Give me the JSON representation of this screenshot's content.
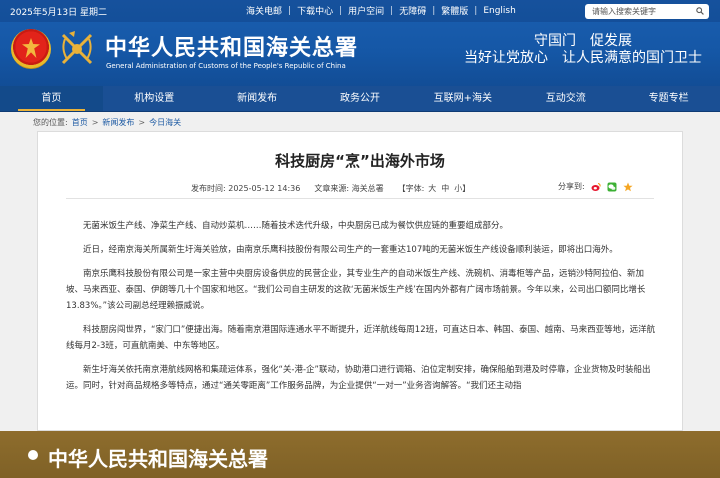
{
  "header": {
    "date": "2025年5月13日 星期二",
    "top_links": [
      "海关电邮",
      "下载中心",
      "用户空间",
      "无障碍",
      "繁體版",
      "English"
    ],
    "search_placeholder": "请输入搜索关键字",
    "site_title_cn": "中华人民共和国海关总署",
    "site_title_en": "General Administration of Customs of the People's Republic of China",
    "slogan_line1": "守国门　促发展",
    "slogan_line2": "当好让党放心　让人民满意的国门卫士"
  },
  "nav": {
    "items": [
      "首页",
      "机构设置",
      "新闻发布",
      "政务公开",
      "互联网+海关",
      "互动交流",
      "专题专栏"
    ],
    "active_index": 0
  },
  "breadcrumb": {
    "label": "您的位置:",
    "items": [
      "首页",
      "新闻发布",
      "今日海关"
    ]
  },
  "article": {
    "title": "科技厨房“烹”出海外市场",
    "publish_time": "发布时间: 2025-05-12 14:36",
    "source": "文章来源: 海关总署",
    "font_size_label": "【字体:",
    "font_big": "大",
    "font_mid": "中",
    "font_small": "小",
    "font_close": "】",
    "share_label": "分享到:",
    "share_icons": [
      "weibo-icon",
      "wechat-icon",
      "star-icon"
    ],
    "paragraphs": [
      "无菌米饭生产线、净菜生产线、自动炒菜机……随着技术迭代升级，中央厨房已成为餐饮供应链的重要组成部分。",
      "近日，经南京海关所属新生圩海关验放，由南京乐鹰科技股份有限公司生产的一套重达107吨的无菌米饭生产线设备顺利装运，即将出口海外。",
      "南京乐鹰科技股份有限公司是一家主营中央厨房设备供应的民营企业，其专业生产的自动米饭生产线、洗碗机、消毒柜等产品，远销沙特阿拉伯、新加坡、马来西亚、泰国、伊朗等几十个国家和地区。“我们公司自主研发的这款‘无菌米饭生产线’在国内外都有广阔市场前景。今年以来，公司出口额同比增长13.83%。”该公司副总经理赖振威说。",
      "科技厨房闯世界，“家门口”便捷出海。随着南京港国际连通水平不断提升，近洋航线每周12班，可直达日本、韩国、泰国、越南、马来西亚等地，远洋航线每月2-3班，可直航南美、中东等地区。",
      "新生圩海关依托南京港航线网格和集疏运体系，强化“关-港-企”联动，协助港口进行调箱、泊位定制安排，确保船舶到港及时停靠，企业货物及时装船出运。同时，针对商品规格多等特点，通过“通关零距离”工作服务品牌，为企业提供“一对一”业务咨询解答。“我们还主动指"
    ]
  },
  "footer": {
    "name": "中华人民共和国海关总署"
  },
  "colors": {
    "header_blue": "#1557a6",
    "nav_blue": "#1a4f94",
    "footer_gold": "#8a6a2c",
    "link_blue": "#1d5aa3"
  }
}
